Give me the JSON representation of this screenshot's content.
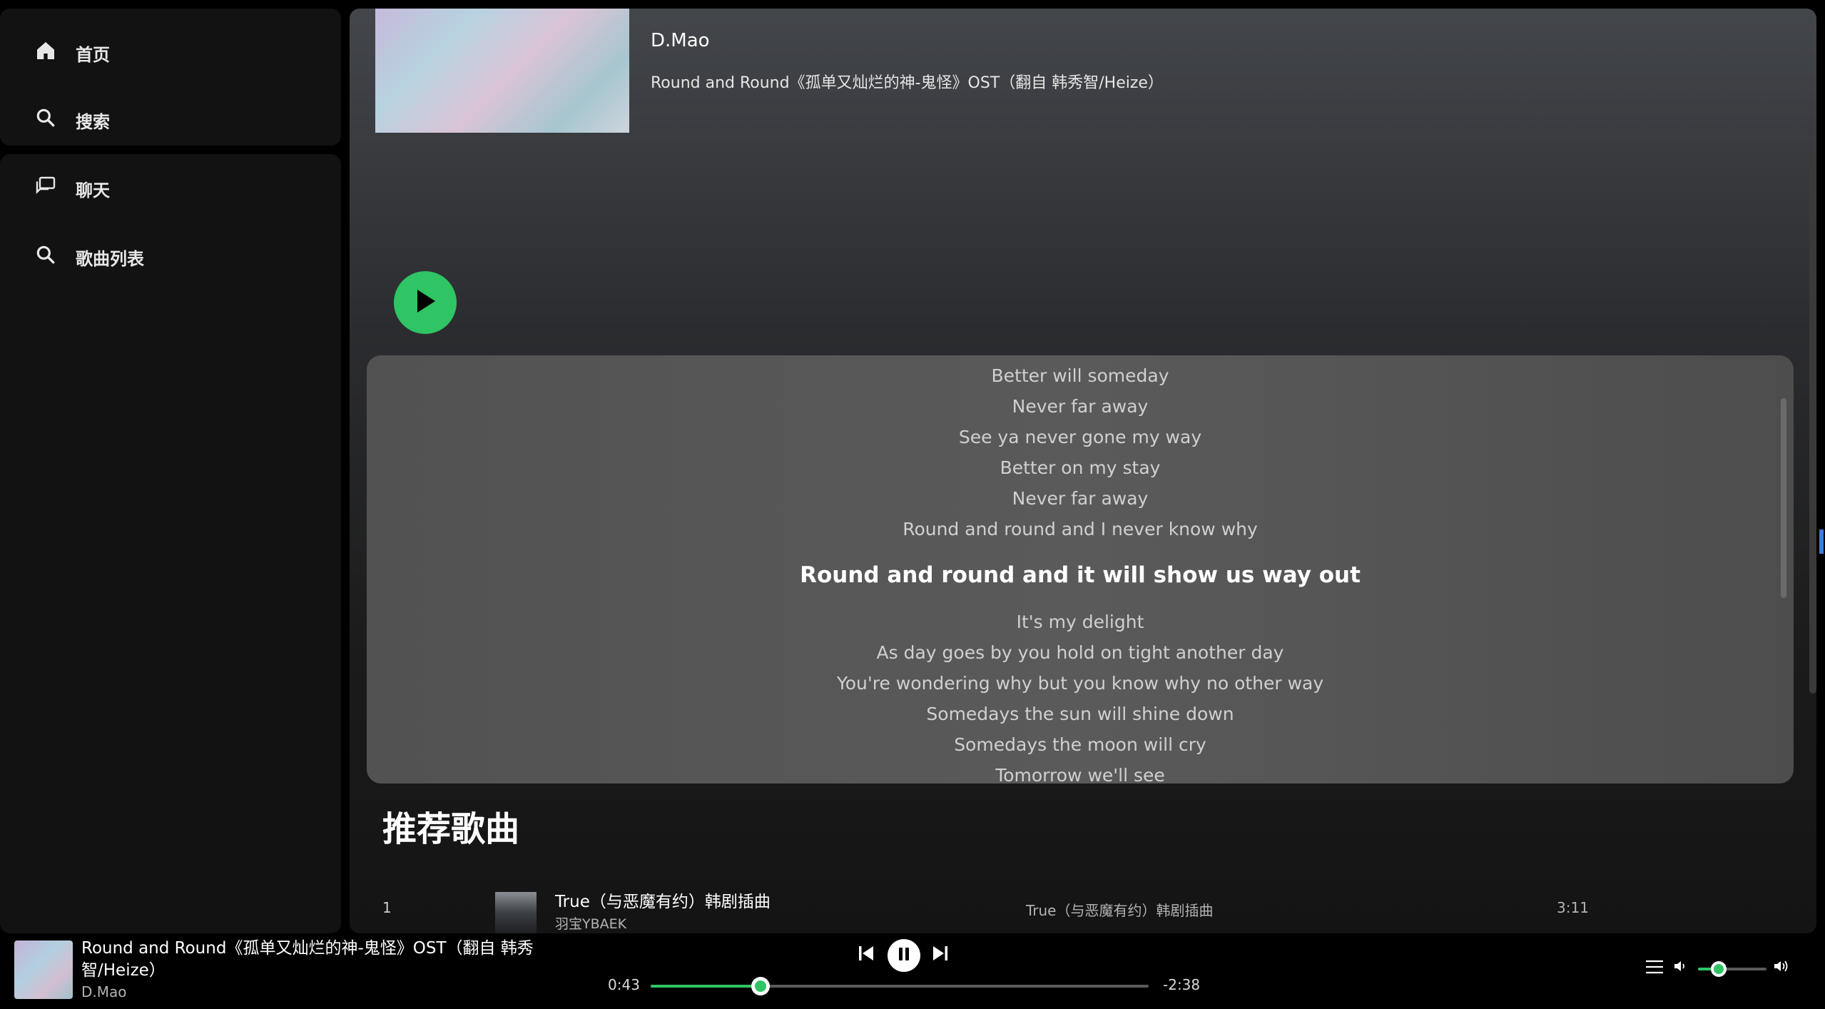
{
  "sidebar": {
    "home_label": "首页",
    "search_label": "搜索",
    "chat_label": "聊天",
    "playlist_label": "歌曲列表"
  },
  "header": {
    "artist": "D.Mao",
    "song_title": "Round and Round《孤单又灿烂的神-鬼怪》OST（翻自 韩秀智/Heize）"
  },
  "lyrics": {
    "before": [
      "Better will someday",
      "Never far away",
      "See ya never gone my way",
      "Better on my stay",
      "Never far away",
      "Round and round and I never know why"
    ],
    "current": "Round and round and it will show us way out",
    "after": [
      "It's my delight",
      "As day goes by you hold on tight another day",
      "You're wondering why but you know why no other way",
      "Somedays the sun will shine down",
      "Somedays the moon will cry",
      "Tomorrow we'll see"
    ]
  },
  "recommended": {
    "title": "推荐歌曲",
    "items": [
      {
        "index": "1",
        "song": "True（与恶魔有约）韩剧插曲",
        "artist": "羽宝YBAEK",
        "album": "True（与恶魔有约）韩剧插曲",
        "duration": "3:11"
      }
    ]
  },
  "player": {
    "now_playing_title": "Round and Round《孤单又灿烂的神-鬼怪》OST（翻自 韩秀智/Heize）",
    "now_playing_artist": "D.Mao",
    "elapsed": "0:43",
    "remaining": "-2:38",
    "progress_fraction": 0.22,
    "volume_fraction": 0.3,
    "is_playing": true
  },
  "colors": {
    "accent": "#2fc464",
    "sidebar_bg": "#121212",
    "lyrics_bg": "#555555"
  },
  "icons": [
    "home-icon",
    "search-icon",
    "chat-icon",
    "play-icon",
    "pause-icon",
    "previous-icon",
    "next-icon",
    "queue-icon",
    "volume-low-icon",
    "volume-high-icon"
  ]
}
